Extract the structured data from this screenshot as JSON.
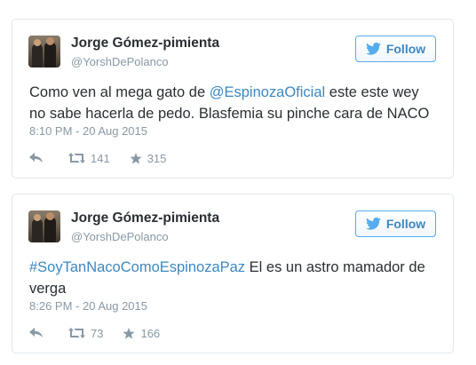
{
  "tweets": [
    {
      "author_name": "Jorge Gómez-pimienta",
      "handle": "@YorshDePolanco",
      "follow_label": "Follow",
      "text_parts": [
        "Como ven al mega gato de ",
        "@EspinozaOficial",
        " este este wey no sabe hacerla de pedo. Blasfemia su pinche cara de NACO"
      ],
      "timestamp": "8:10 PM - 20 Aug 2015",
      "retweets": "141",
      "favorites": "315"
    },
    {
      "author_name": "Jorge Gómez-pimienta",
      "handle": "@YorshDePolanco",
      "follow_label": "Follow",
      "text_parts": [
        "#SoyTanNacoComoEspinozaPaz",
        " El es un astro mamador de verga"
      ],
      "timestamp": "8:26 PM - 20 Aug 2015",
      "retweets": "73",
      "favorites": "166"
    }
  ],
  "icons": {
    "follow": "twitter-bird-icon",
    "reply": "reply-icon",
    "retweet": "retweet-icon",
    "favorite": "star-icon"
  },
  "colors": {
    "link": "#3b88c3",
    "follow_border": "#55acee",
    "meta": "#8899a6",
    "text": "#292f33"
  }
}
